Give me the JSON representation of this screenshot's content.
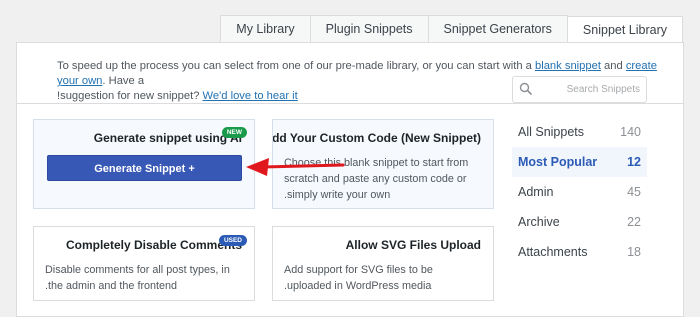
{
  "tabs": [
    {
      "label": "My Library"
    },
    {
      "label": "Plugin Snippets"
    },
    {
      "label": "Snippet Generators"
    },
    {
      "label": "Snippet Library"
    }
  ],
  "intro": {
    "line1_pre": "To speed up the process you can select from one of our pre-made library, or you can start with a ",
    "blank_link": "blank snippet",
    "and": " and ",
    "create_link": "create your own",
    "line1_post": ". Have a",
    "line2_pre": "suggestion for new snippet? ",
    "love_link": "We'd love to hear it",
    "line2_post": "!"
  },
  "cards": {
    "generate": {
      "title": "Generate snippet using AI",
      "badge": "NEW",
      "button": "Generate Snippet +"
    },
    "custom": {
      "title": "Add Your Custom Code (New Snippet)",
      "desc": "Choose this blank snippet to start from scratch and paste any custom code or simply write your own."
    },
    "comments": {
      "title": "Completely Disable Comments",
      "badge": "USED",
      "desc": "Disable comments for all post types, in the admin and the frontend."
    },
    "svg": {
      "title": "Allow SVG Files Upload",
      "desc": "Add support for SVG files to be uploaded in WordPress media."
    }
  },
  "sidebar": {
    "search_placeholder": "Search Snippets",
    "categories": [
      {
        "label": "All Snippets",
        "count": "140"
      },
      {
        "label": "Most Popular",
        "count": "12"
      },
      {
        "label": "Admin",
        "count": "45"
      },
      {
        "label": "Archive",
        "count": "22"
      },
      {
        "label": "Attachments",
        "count": "18"
      }
    ]
  },
  "colors": {
    "accent": "#3858b6",
    "new_badge": "#1a9b4b",
    "used_badge": "#2c5bb6",
    "arrow": "#e1171e"
  }
}
